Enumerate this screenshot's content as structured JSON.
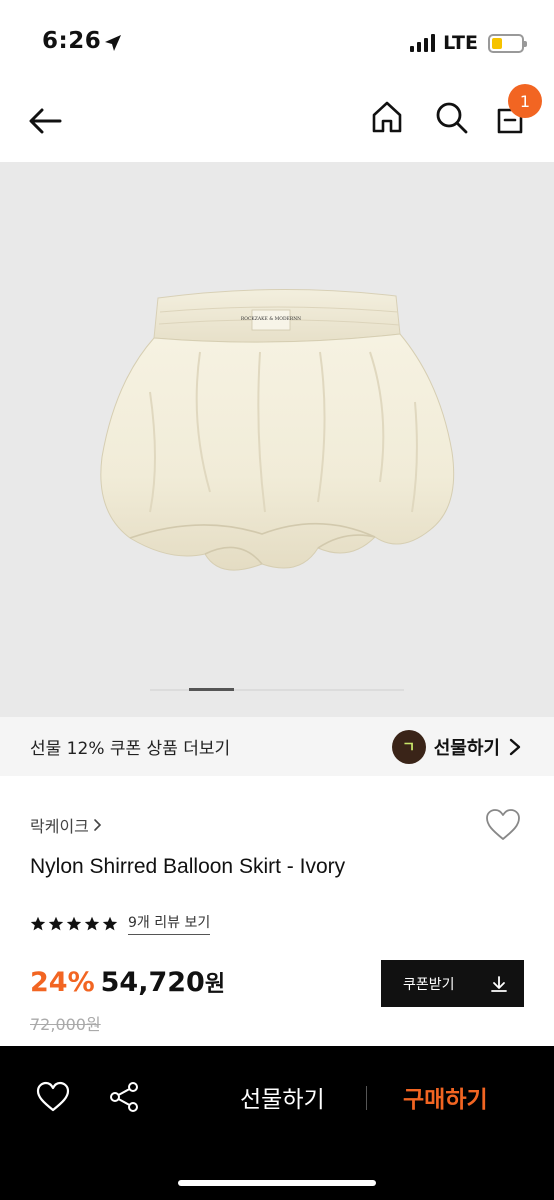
{
  "status_bar": {
    "time": "6:26",
    "network": "LTE"
  },
  "nav": {
    "cart_count": "1",
    "icons": [
      "back-arrow-icon",
      "home-icon",
      "search-icon",
      "shopping-bag-icon"
    ]
  },
  "gallery": {
    "logo_text": "ROCKZAKE & MODERNN",
    "slide_position": 0.33
  },
  "gift_banner": {
    "text": "선물 12% 쿠폰 상품 더보기",
    "logo_text": "ㄱ",
    "link_label": "선물하기"
  },
  "product": {
    "brand": "락케이크",
    "title": "Nylon Shirred Balloon Skirt - Ivory",
    "rating_stars": 5,
    "review_label": "9개 리뷰 보기",
    "discount": "24%",
    "price": "54,720",
    "currency": "원",
    "original_price": "72,000원",
    "coupon_label": "쿠폰받기"
  },
  "bottom_bar": {
    "gift_label": "선물하기",
    "buy_label": "구매하기"
  },
  "colors": {
    "accent": "#f26522",
    "bottom_bar": "#000000",
    "gallery_bg": "#e9e9e9",
    "banner_bg": "#f5f5f5"
  }
}
